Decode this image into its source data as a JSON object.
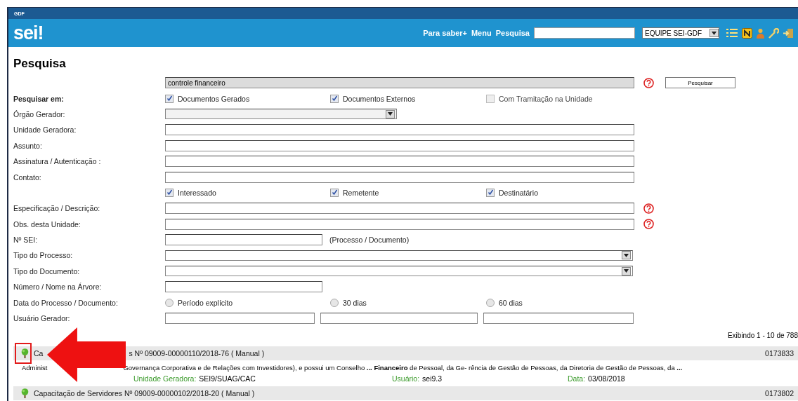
{
  "header": {
    "org": "GDF",
    "logo": "sei!",
    "links": [
      "Para saber+",
      "Menu",
      "Pesquisa"
    ],
    "unit_select": {
      "value": "EQUIPE SEI-GDF"
    }
  },
  "page_title": "Pesquisa",
  "form": [
    {
      "kind": "query",
      "value": "controle financeiro",
      "help": true,
      "button": "Pesquisar"
    },
    {
      "kind": "checks",
      "label": "Pesquisar em:",
      "bold": true,
      "options": [
        {
          "label": "Documentos Gerados",
          "checked": true,
          "disabled": false
        },
        {
          "label": "Documentos Externos",
          "checked": true,
          "disabled": false
        },
        {
          "label": "Com Tramitação na Unidade",
          "checked": false,
          "disabled": true
        }
      ]
    },
    {
      "kind": "short-select",
      "label": "Órgão Gerador:"
    },
    {
      "kind": "text",
      "label": "Unidade Geradora:"
    },
    {
      "kind": "text",
      "label": "Assunto:"
    },
    {
      "kind": "text",
      "label": "Assinatura / Autenticação :"
    },
    {
      "kind": "text",
      "label": "Contato:"
    },
    {
      "kind": "checks",
      "options": [
        {
          "label": "Interessado",
          "checked": true,
          "disabled": false
        },
        {
          "label": "Remetente",
          "checked": true,
          "disabled": false
        },
        {
          "label": "Destinatário",
          "checked": true,
          "disabled": false
        }
      ]
    },
    {
      "kind": "text",
      "label": "Especificação / Descrição:",
      "help": true
    },
    {
      "kind": "text",
      "label": "Obs. desta Unidade:",
      "help": true
    },
    {
      "kind": "short-text",
      "label": "Nº SEI:",
      "note": "(Processo / Documento)"
    },
    {
      "kind": "select",
      "label": "Tipo do Processo:"
    },
    {
      "kind": "select",
      "label": "Tipo do Documento:"
    },
    {
      "kind": "short-text",
      "label": "Número / Nome na Árvore:"
    },
    {
      "kind": "radios",
      "label": "Data do Processo / Documento:",
      "options": [
        {
          "label": "Período explícito",
          "selected": false
        },
        {
          "label": "30 dias",
          "selected": false
        },
        {
          "label": "60 dias",
          "selected": false
        }
      ]
    },
    {
      "kind": "triple",
      "label": "Usuário Gerador:"
    }
  ],
  "results_count": "Exibindo 1 - 10 de 788",
  "results": [
    {
      "title_parts": [
        "Ca",
        "s Nº 09009-00000110/2018-76 ( Manual )"
      ],
      "number": "0173833",
      "snippet_parts": [
        "Administ",
        "Governança Corporativa e de Relações com Investidores), e possui um Conselho **...** **Financeiro** de Pessoal, da Ge- rência de Gestão de Pessoas, da Diretoria de Gestão de Pessoas, da **...**"
      ],
      "meta": [
        {
          "label": "Unidade Geradora:",
          "value": "SEI9/SUAG/CAC"
        },
        {
          "label": "Usuário:",
          "value": "sei9.3"
        },
        {
          "label": "Data:",
          "value": "03/08/2018"
        }
      ],
      "highlighted": true
    },
    {
      "title_parts": [
        "Capacitação de Servidores Nº 09009-00000102/2018-20 ( Manual )"
      ],
      "number": "0173802",
      "highlighted": false
    }
  ]
}
